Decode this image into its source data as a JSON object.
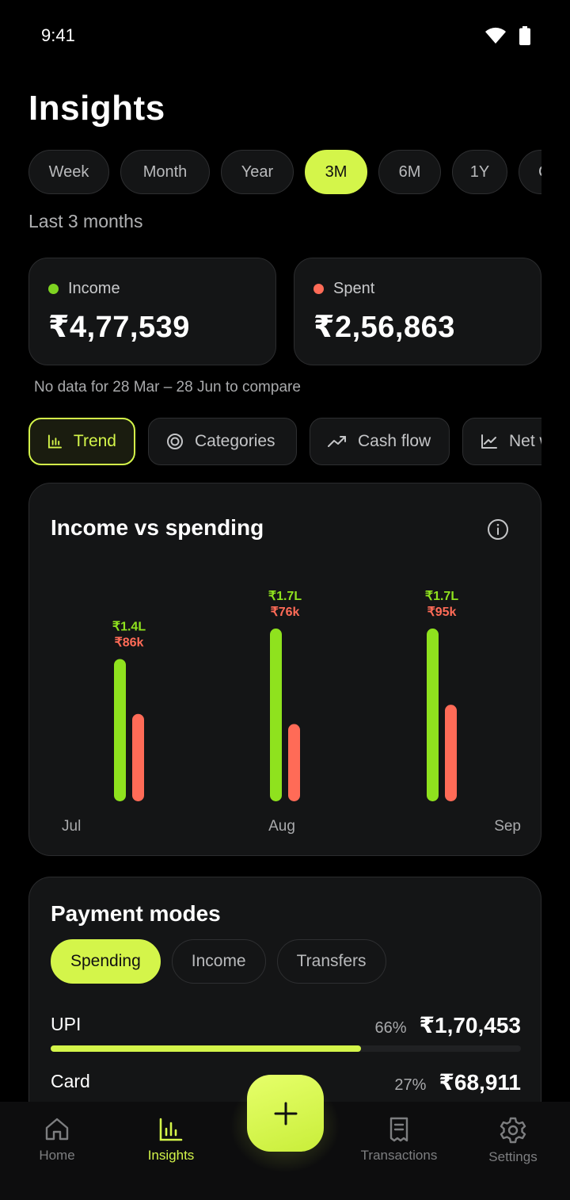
{
  "status_bar": {
    "time": "9:41"
  },
  "header": {
    "title": "Insights"
  },
  "range_options": [
    "Week",
    "Month",
    "Year",
    "3M",
    "6M",
    "1Y",
    "C"
  ],
  "range_selected": "3M",
  "range_caption": "Last 3 months",
  "summary": {
    "income": {
      "label": "Income",
      "value": "₹4,77,539",
      "dot_color": "#7ed321"
    },
    "spent": {
      "label": "Spent",
      "value": "₹2,56,863",
      "dot_color": "#ff6b57"
    },
    "compare_note": "No data for 28 Mar – 28 Jun to compare"
  },
  "view_tabs": [
    {
      "label": "Trend",
      "icon": "bar-chart-icon",
      "active": true
    },
    {
      "label": "Categories",
      "icon": "target-icon",
      "active": false
    },
    {
      "label": "Cash flow",
      "icon": "trending-up-icon",
      "active": false
    },
    {
      "label": "Net w",
      "icon": "line-chart-icon",
      "active": false
    }
  ],
  "chart_card": {
    "title": "Income vs spending"
  },
  "chart_data": {
    "type": "bar",
    "title": "Income vs spending",
    "categories": [
      "Jul",
      "Aug",
      "Sep"
    ],
    "series": [
      {
        "name": "Income",
        "color": "#8fe21e",
        "values": [
          140000,
          170000,
          170000
        ],
        "labels": [
          "₹1.4L",
          "₹1.7L",
          "₹1.7L"
        ]
      },
      {
        "name": "Spent",
        "color": "#ff6b57",
        "values": [
          86000,
          76000,
          95000
        ],
        "labels": [
          "₹86k",
          "₹76k",
          "₹95k"
        ]
      }
    ],
    "ylim": [
      0,
      170000
    ],
    "grid": false
  },
  "payment_modes": {
    "title": "Payment modes",
    "filters": [
      "Spending",
      "Income",
      "Transfers"
    ],
    "selected_filter": "Spending",
    "rows": [
      {
        "name": "UPI",
        "percent": "66%",
        "share": 0.66,
        "amount": "₹1,70,453"
      },
      {
        "name": "Card",
        "percent": "27%",
        "share": 0.27,
        "amount": "₹68,911"
      }
    ]
  },
  "bottom_nav": [
    {
      "label": "Home",
      "icon": "home-icon",
      "active": false
    },
    {
      "label": "Insights",
      "icon": "bar-chart-icon",
      "active": true
    },
    {
      "label": "Transactions",
      "icon": "receipt-icon",
      "active": false
    },
    {
      "label": "Settings",
      "icon": "gear-icon",
      "active": false
    }
  ],
  "accent_color": "#d4f54a"
}
